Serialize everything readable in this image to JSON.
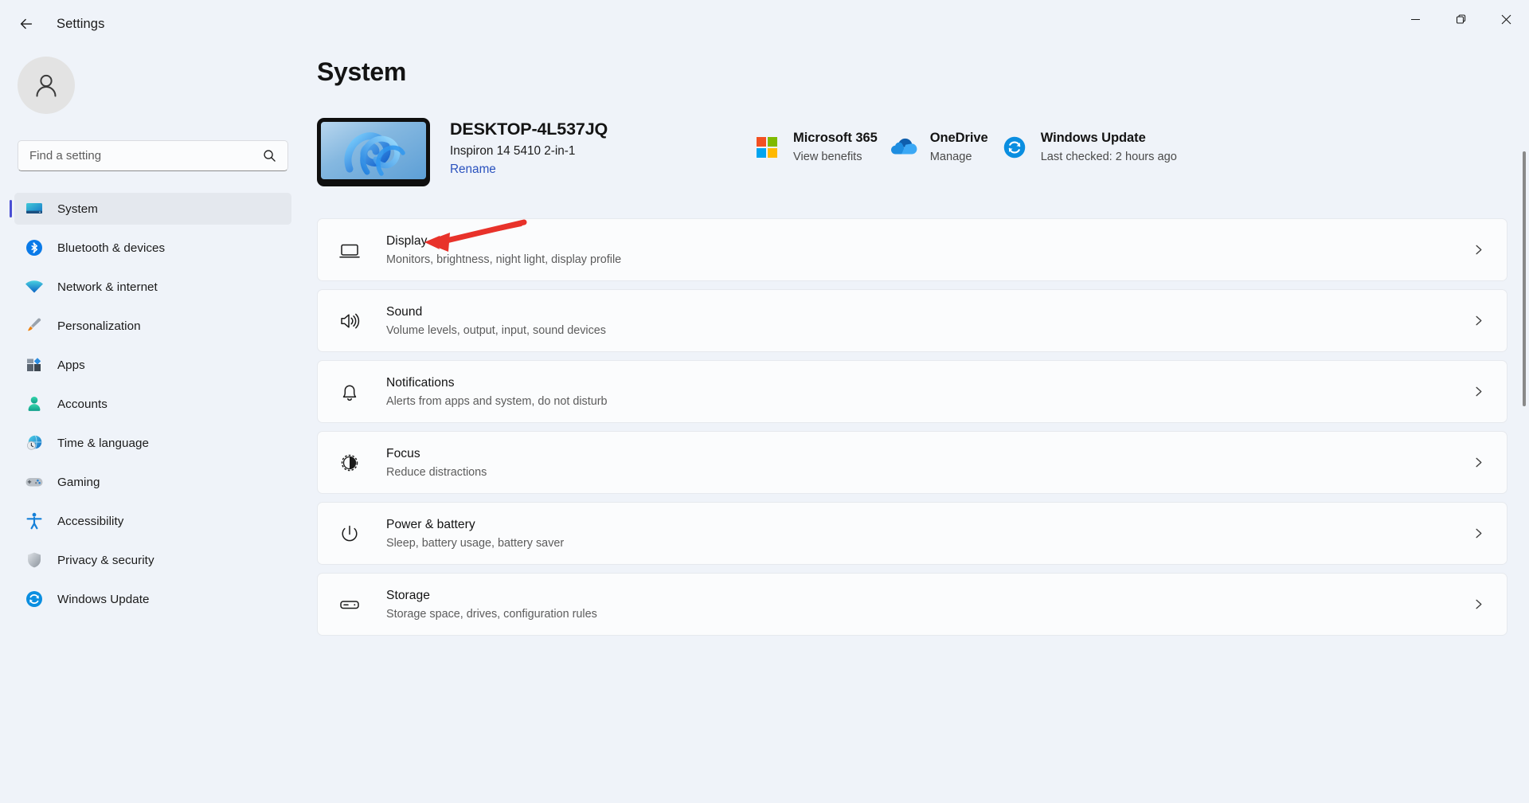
{
  "titlebar": {
    "back_label": "back-arrow",
    "title": "Settings",
    "minimize": "minimize-icon",
    "maximize": "maximize-icon",
    "close": "close-icon"
  },
  "sidebar": {
    "avatar": "user-avatar",
    "search": {
      "placeholder": "Find a setting",
      "value": ""
    },
    "items": [
      {
        "label": "System",
        "icon": "monitor-icon",
        "active": true
      },
      {
        "label": "Bluetooth & devices",
        "icon": "bluetooth-icon",
        "active": false
      },
      {
        "label": "Network & internet",
        "icon": "wifi-icon",
        "active": false
      },
      {
        "label": "Personalization",
        "icon": "paintbrush-icon",
        "active": false
      },
      {
        "label": "Apps",
        "icon": "apps-icon",
        "active": false
      },
      {
        "label": "Accounts",
        "icon": "person-icon",
        "active": false
      },
      {
        "label": "Time & language",
        "icon": "globe-clock-icon",
        "active": false
      },
      {
        "label": "Gaming",
        "icon": "gamepad-icon",
        "active": false
      },
      {
        "label": "Accessibility",
        "icon": "accessibility-icon",
        "active": false
      },
      {
        "label": "Privacy & security",
        "icon": "shield-icon",
        "active": false
      },
      {
        "label": "Windows Update",
        "icon": "update-refresh-icon",
        "active": false
      }
    ]
  },
  "main": {
    "page_title": "System",
    "device": {
      "name": "DESKTOP-4L537JQ",
      "model": "Inspiron 14 5410 2-in-1",
      "rename_label": "Rename",
      "thumbnail": "windows-bloom-wallpaper"
    },
    "quick_links": [
      {
        "title": "Microsoft 365",
        "subtitle": "View benefits",
        "icon": "microsoft-logo-icon"
      },
      {
        "title": "OneDrive",
        "subtitle": "Manage",
        "icon": "onedrive-cloud-icon"
      },
      {
        "title": "Windows Update",
        "subtitle": "Last checked: 2 hours ago",
        "icon": "update-refresh-icon"
      }
    ],
    "settings": [
      {
        "title": "Display",
        "subtitle": "Monitors, brightness, night light, display profile",
        "icon": "display-monitor-icon"
      },
      {
        "title": "Sound",
        "subtitle": "Volume levels, output, input, sound devices",
        "icon": "speaker-icon"
      },
      {
        "title": "Notifications",
        "subtitle": "Alerts from apps and system, do not disturb",
        "icon": "bell-icon"
      },
      {
        "title": "Focus",
        "subtitle": "Reduce distractions",
        "icon": "focus-moon-icon"
      },
      {
        "title": "Power & battery",
        "subtitle": "Sleep, battery usage, battery saver",
        "icon": "power-icon"
      },
      {
        "title": "Storage",
        "subtitle": "Storage space, drives, configuration rules",
        "icon": "storage-drive-icon"
      }
    ]
  },
  "annotation": {
    "type": "red-arrow",
    "color": "#e8322a",
    "points_to": "Display"
  }
}
